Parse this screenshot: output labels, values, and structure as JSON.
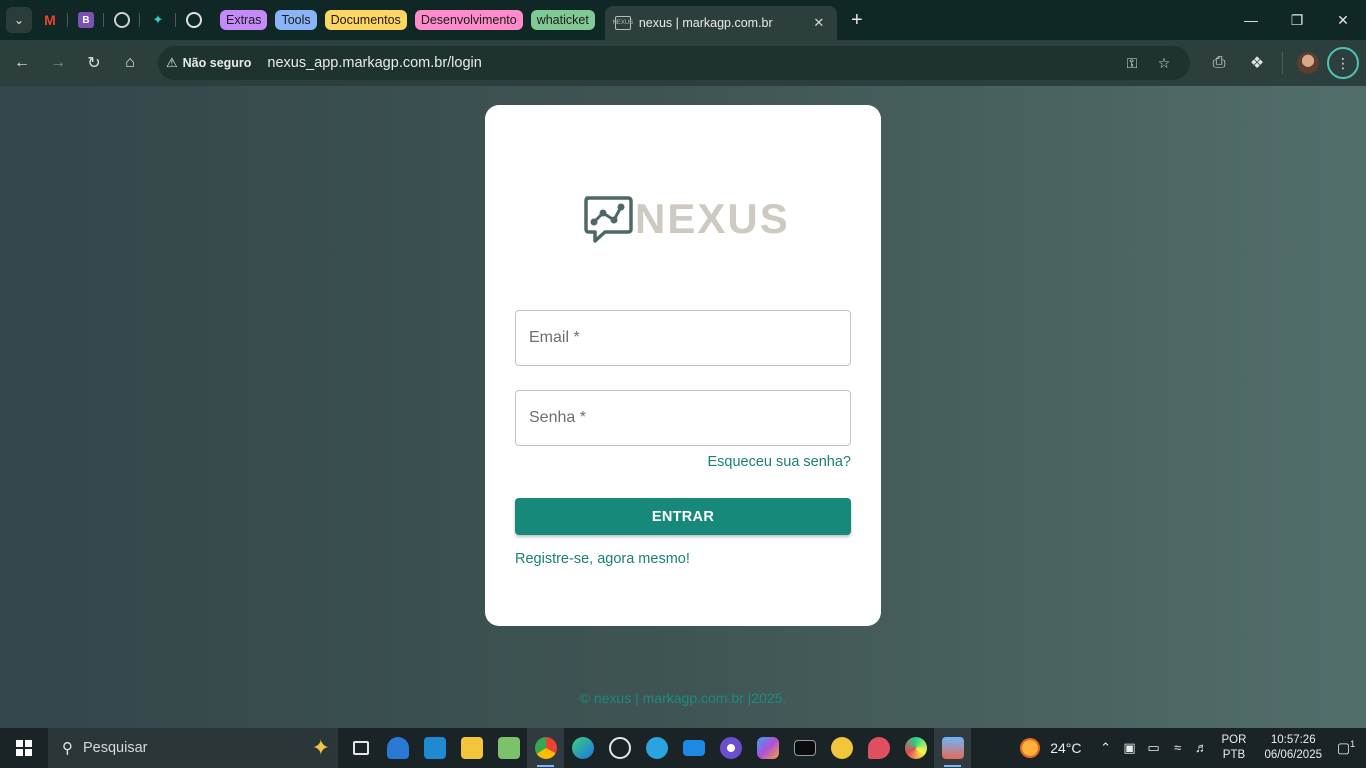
{
  "browser": {
    "tab_groups": [
      {
        "label": "Extras",
        "color": "#c58af9"
      },
      {
        "label": "Tools",
        "color": "#8ab4f8"
      },
      {
        "label": "Documentos",
        "color": "#fdd663"
      },
      {
        "label": "Desenvolvimento",
        "color": "#ff8bcb"
      },
      {
        "label": "whaticket",
        "color": "#81c995"
      }
    ],
    "active_tab": {
      "title": "nexus | markagp.com.br",
      "favicon_text": "NEXUS"
    },
    "security_label": "Não seguro",
    "url": "nexus_app.markagp.com.br/login"
  },
  "login": {
    "logo_text": "NEXUS",
    "email_placeholder": "Email *",
    "password_placeholder": "Senha *",
    "forgot_link": "Esqueceu sua senha?",
    "submit_label": "ENTRAR",
    "register_link": "Registre-se, agora mesmo!",
    "accent_color": "#16897b"
  },
  "footer": {
    "text": "© nexus | markagp.com.br |2025."
  },
  "taskbar": {
    "search_placeholder": "Pesquisar",
    "weather": "24°C",
    "lang_line1": "POR",
    "lang_line2": "PTB",
    "time": "10:57:26",
    "date": "06/06/2025",
    "notification_count": "1"
  }
}
